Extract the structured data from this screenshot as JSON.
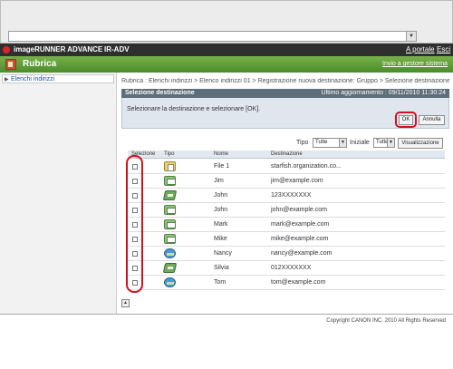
{
  "browser": {
    "dropdown_glyph": "▼"
  },
  "header": {
    "product": "imageRUNNER ADVANCE",
    "device": "IR-ADV",
    "portal_link": "A portale",
    "exit_link": "Esci"
  },
  "title_bar": {
    "title": "Rubrica",
    "send_link": "Invio a gestore sistema",
    "icon": "address-book-icon"
  },
  "sidebar": {
    "items": [
      {
        "label": "Elenchi indirizzi",
        "icon": "triangle-right-icon"
      }
    ]
  },
  "breadcrumb": "Rubrica : Elenchi indirizzi > Elenco indirizzi 01 > Registrazione nuova destinazione: Gruppo > Selezione destinazione",
  "panel": {
    "title": "Selezione destinazione",
    "last_update": "Ultimo aggiornamento : 09/11/2010 11:30:24",
    "instruction": "Selezionare la destinazione e selezionare [OK].",
    "ok_label": "OK",
    "cancel_label": "Annulla"
  },
  "filter": {
    "type_label": "Tipo",
    "type_value": "Tutte",
    "initial_label": "Iniziale",
    "initial_value": "Tutte",
    "view_label": "Visualizzazione",
    "dropdown_glyph": "▼"
  },
  "table": {
    "headers": {
      "select": "Selezione",
      "type": "Tipo",
      "name": "Nome",
      "destination": "Destinazione"
    },
    "rows": [
      {
        "type": "file",
        "name": "File 1",
        "destination": "starfish.organization.co..."
      },
      {
        "type": "email",
        "name": "Jim",
        "destination": "jim@example.com"
      },
      {
        "type": "fax",
        "name": "John",
        "destination": "123XXXXXXX"
      },
      {
        "type": "email",
        "name": "John",
        "destination": "john@example.com"
      },
      {
        "type": "email",
        "name": "Mark",
        "destination": "mark@example.com"
      },
      {
        "type": "email",
        "name": "Mike",
        "destination": "mike@example.com"
      },
      {
        "type": "ifax",
        "name": "Nancy",
        "destination": "nancy@example.com"
      },
      {
        "type": "fax",
        "name": "Silvia",
        "destination": "012XXXXXXX"
      },
      {
        "type": "ifax",
        "name": "Tom",
        "destination": "tom@example.com"
      }
    ]
  },
  "scroll_top_glyph": "▲",
  "footer": {
    "copyright": "Copyright CANON INC. 2010 All Rights Reserved"
  },
  "colors": {
    "highlight": "#d0121e",
    "title_green": "#5b9a35",
    "header_dark": "#2f2f2f"
  }
}
